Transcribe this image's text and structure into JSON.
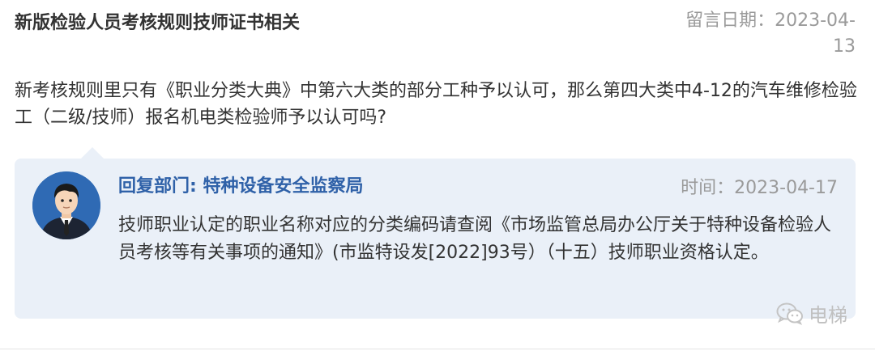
{
  "message": {
    "title": "新版检验人员考核规则技师证书相关",
    "date_line1": "留言日期：2023-04-",
    "date_line2": "13",
    "question": "新考核规则里只有《职业分类大典》中第六大类的部分工种予以认可，那么第四大类中4-12的汽车维修检验工（二级/技师）报名机电类检验师予以认可吗?"
  },
  "reply": {
    "department": "回复部门: 特种设备安全监察局",
    "time": "时间：2023-04-17",
    "content": "技师职业认定的职业名称对应的分类编码请查阅《市场监管总局办公厅关于特种设备检验人员考核等有关事项的通知》(市监特设发[2022]93号）（十五）技师职业资格认定。",
    "avatar_icon": "official-avatar-icon",
    "card_color": "#eaf0f8",
    "dept_color": "#2f61a8"
  },
  "watermark": {
    "icon": "wechat-icon",
    "label": "电梯"
  }
}
